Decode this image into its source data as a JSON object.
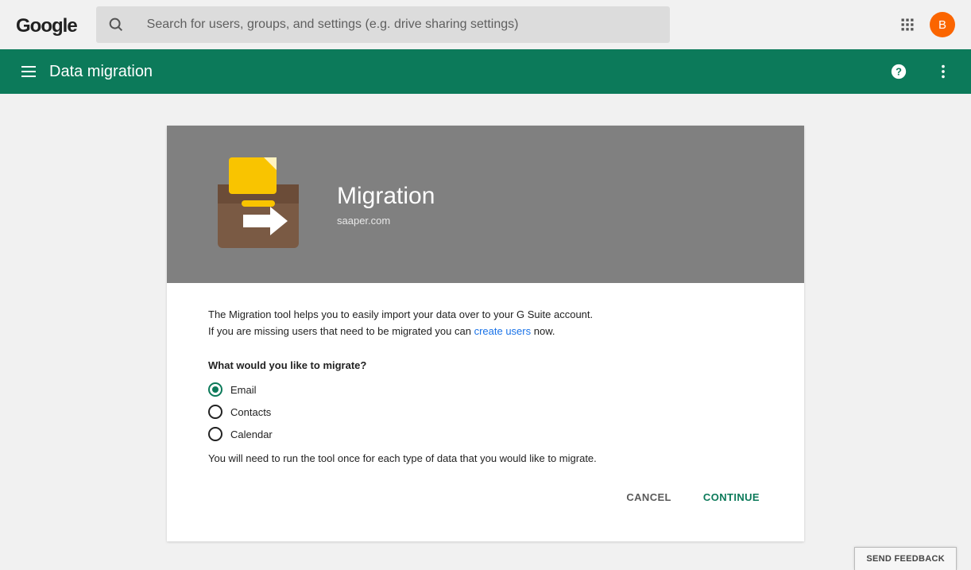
{
  "topbar": {
    "search_placeholder": "Search for users, groups, and settings (e.g. drive sharing settings)",
    "avatar_initial": "B"
  },
  "appbar": {
    "title": "Data migration"
  },
  "hero": {
    "title": "Migration",
    "domain": "saaper.com"
  },
  "body": {
    "line1": "The Migration tool helps you to easily import your data over to your G Suite account.",
    "line2_prefix": "If you are missing users that need to be migrated you can ",
    "line2_link": "create users",
    "line2_suffix": " now.",
    "question": "What would you like to migrate?",
    "options": [
      {
        "label": "Email",
        "selected": true
      },
      {
        "label": "Contacts",
        "selected": false
      },
      {
        "label": "Calendar",
        "selected": false
      }
    ],
    "note": "You will need to run the tool once for each type of data that you would like to migrate."
  },
  "actions": {
    "cancel": "CANCEL",
    "continue": "CONTINUE"
  },
  "feedback": {
    "label": "SEND FEEDBACK"
  }
}
